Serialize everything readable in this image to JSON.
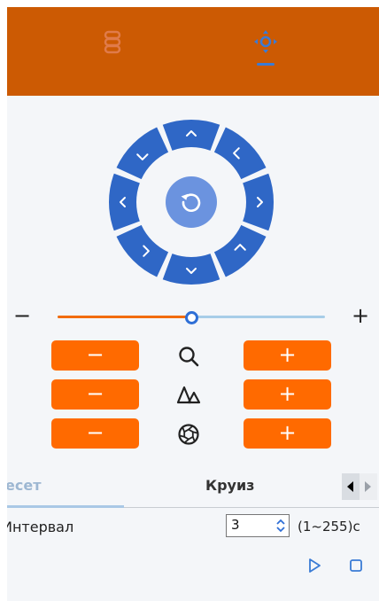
{
  "colors": {
    "topbar": "#cc5a03",
    "accent_orange": "#ff6a00",
    "ptz_blue": "#2f67c6",
    "ptz_center": "#6b93df",
    "active_blue": "#3a7bd5"
  },
  "topbar": {
    "icons": [
      "layers-icon",
      "ptz-move-icon"
    ],
    "active_index": 1
  },
  "ptz": {
    "directions": [
      "up",
      "up-right",
      "right",
      "down-right",
      "down",
      "down-left",
      "left",
      "up-left"
    ],
    "center_icon": "rotate-reset-icon"
  },
  "zoom": {
    "minus_label": "−",
    "plus_label": "+",
    "level_percent": 50
  },
  "controls": [
    {
      "name": "zoom",
      "icon": "magnifier-icon",
      "minus_label": "−",
      "plus_label": "+"
    },
    {
      "name": "focus",
      "icon": "focus-triangles-icon",
      "minus_label": "−",
      "plus_label": "+"
    },
    {
      "name": "iris",
      "icon": "aperture-icon",
      "minus_label": "−",
      "plus_label": "+"
    }
  ],
  "tabs": {
    "preset": "есет",
    "cruise": "Круиз"
  },
  "interval": {
    "label": "Интервал",
    "value": "3",
    "range": "(1~255)с"
  },
  "playback": {
    "play_icon": "play-icon",
    "stop_icon": "stop-icon"
  }
}
